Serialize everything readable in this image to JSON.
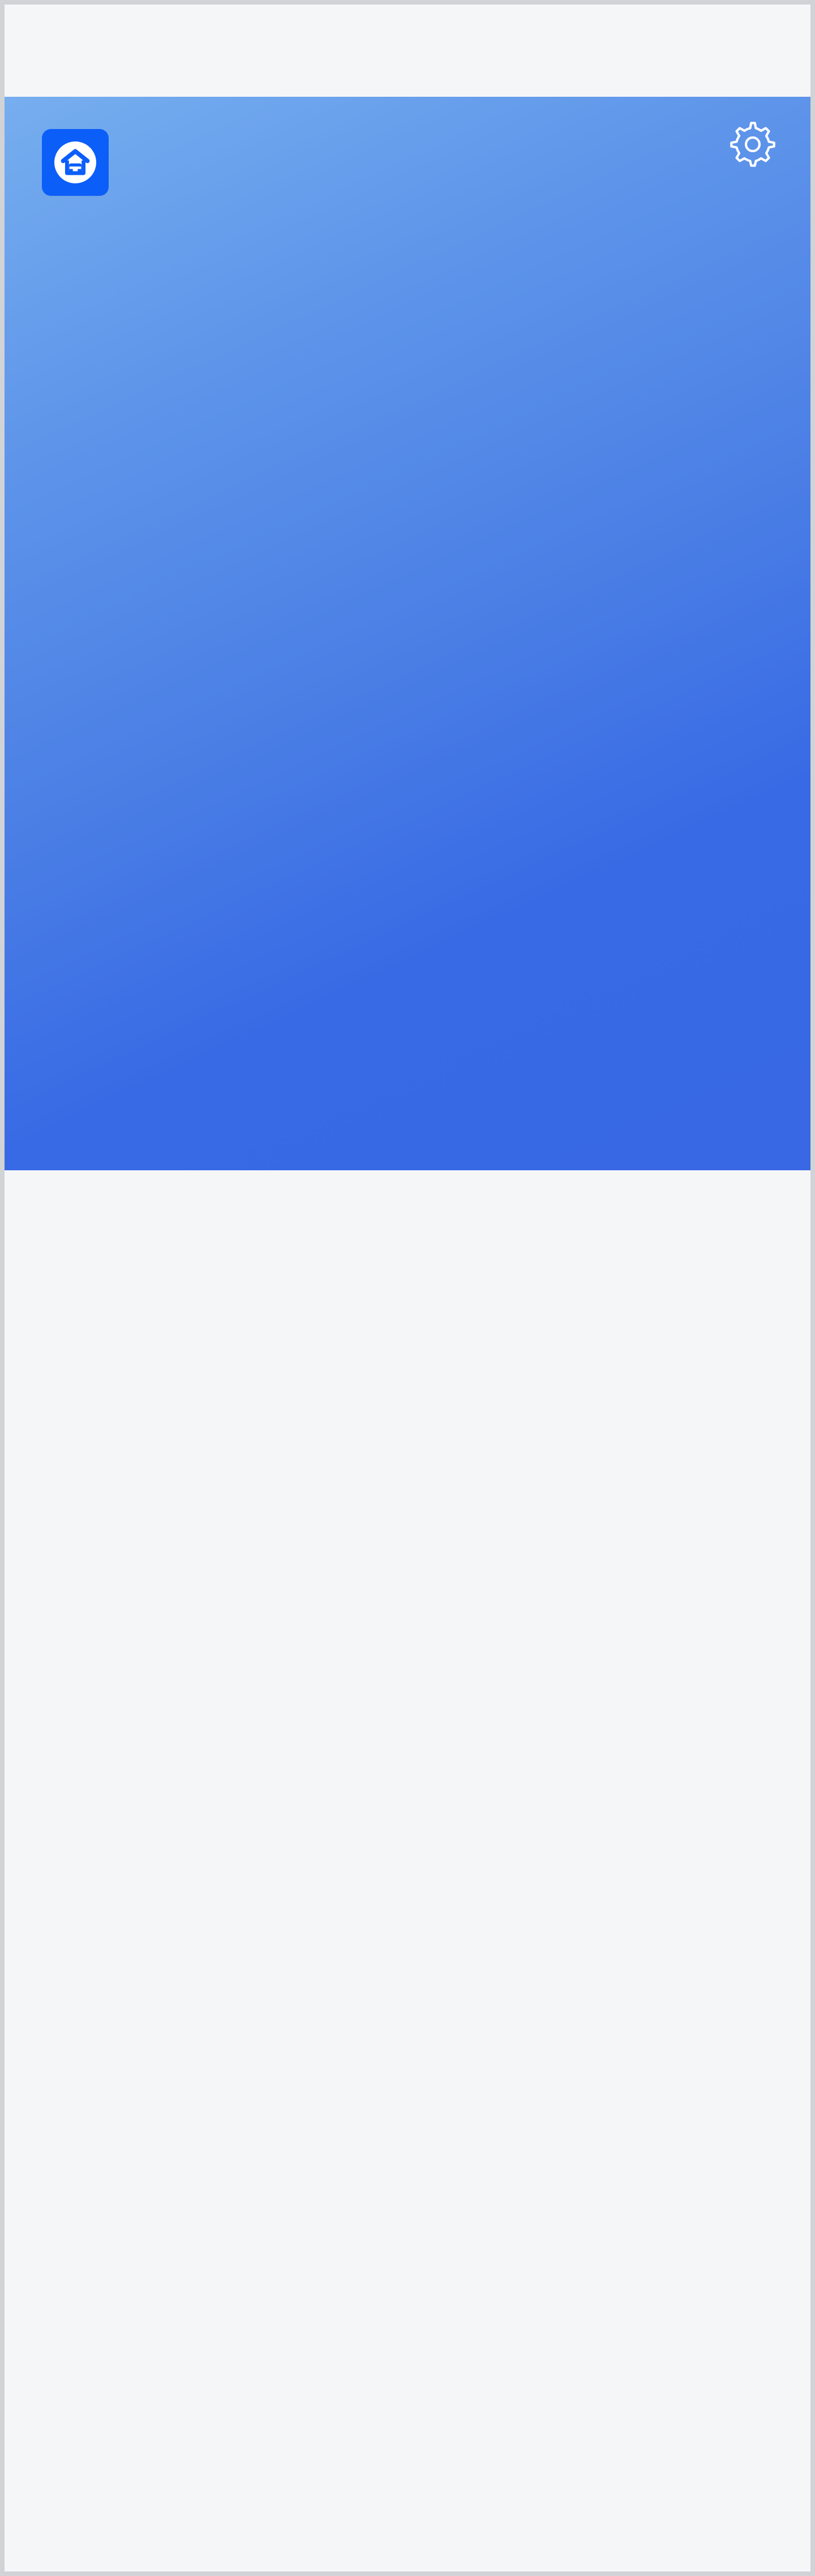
{
  "header": {
    "logo_icon": "home-logo-icon",
    "settings_icon": "gear-icon"
  },
  "colors": {
    "page_background": "#f5f6f8",
    "hero_gradient_start": "#76aeef",
    "hero_gradient_end": "#3868e4",
    "logo_background": "#0c5ef9",
    "icon_white": "#ffffff"
  }
}
